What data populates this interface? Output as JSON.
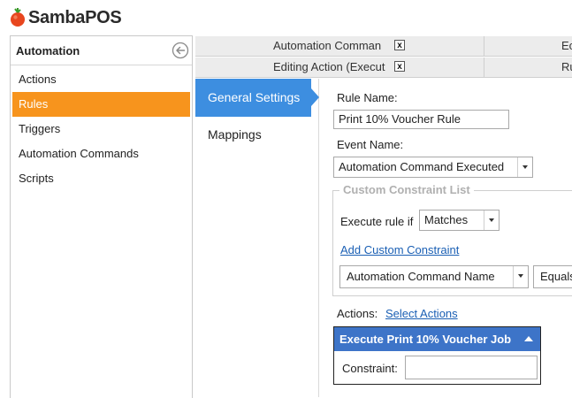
{
  "app": {
    "logo_text": "SambaPOS"
  },
  "left_panel": {
    "title": "Automation",
    "items": [
      {
        "label": "Actions",
        "active": false
      },
      {
        "label": "Rules",
        "active": true
      },
      {
        "label": "Triggers",
        "active": false
      },
      {
        "label": "Automation Commands",
        "active": false
      },
      {
        "label": "Scripts",
        "active": false
      }
    ]
  },
  "doc_tabs": {
    "row1": [
      {
        "label": "Automation Comman",
        "close": "x"
      },
      {
        "label": "Ec"
      }
    ],
    "row2": [
      {
        "label": "Editing Action (Execut",
        "close": "x"
      },
      {
        "label": "Ru"
      }
    ]
  },
  "settings_nav": {
    "general": "General Settings",
    "mappings": "Mappings"
  },
  "form": {
    "rule_name_label": "Rule Name:",
    "rule_name_value": "Print 10% Voucher Rule",
    "event_name_label": "Event Name:",
    "event_name_value": "Automation Command Executed",
    "constraint_group_title": "Custom Constraint List",
    "execute_rule_label": "Execute rule if",
    "execute_rule_value": "Matches",
    "add_constraint_link": "Add Custom Constraint",
    "constraint_field_value": "Automation Command Name",
    "constraint_operator_value": "Equals",
    "actions_label": "Actions:",
    "select_actions_link": "Select Actions"
  },
  "action_card": {
    "title": "Execute Print 10% Voucher Job",
    "constraint_label": "Constraint:",
    "constraint_value": ""
  },
  "colors": {
    "accent_orange": "#f7941d",
    "accent_blue": "#3d8ee0",
    "card_header_blue": "#3d74c8",
    "link_blue": "#1a5fb4"
  }
}
